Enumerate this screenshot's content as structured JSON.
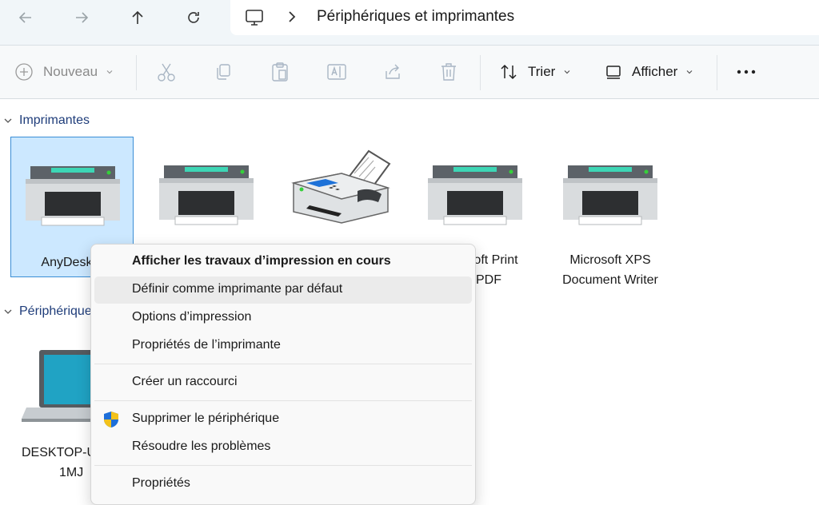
{
  "nav": {
    "back_icon": "arrow-left-icon",
    "forward_icon": "arrow-right-icon",
    "up_icon": "arrow-up-icon",
    "refresh_icon": "refresh-icon",
    "location_icon": "monitor-icon",
    "breadcrumb": "Périphériques et imprimantes"
  },
  "toolbar": {
    "new_label": "Nouveau",
    "sort_label": "Trier",
    "view_label": "Afficher",
    "more_icon": "more-icon"
  },
  "groups": {
    "printers_header": "Imprimantes",
    "devices_header": "Périphérique"
  },
  "printers": [
    {
      "name": "AnyDesk P",
      "icon": "printer-icon",
      "selected": true
    },
    {
      "name": "",
      "icon": "printer-icon"
    },
    {
      "name": "",
      "icon": "fax-icon"
    },
    {
      "name_line1": "oft Print",
      "name_line2": "PDF",
      "icon": "printer-icon"
    },
    {
      "name_line1": "Microsoft XPS",
      "name_line2": "Document Writer",
      "icon": "printer-icon"
    }
  ],
  "devices": [
    {
      "name_line1": "DESKTOP-U",
      "name_line2": "1MJ",
      "icon": "laptop-icon"
    }
  ],
  "context_menu": {
    "items": [
      {
        "label": "Afficher les travaux d’impression en cours",
        "bold": true
      },
      {
        "label": "Définir comme imprimante par défaut",
        "hover": true
      },
      {
        "label": "Options d’impression"
      },
      {
        "label": "Propriétés de l’imprimante"
      },
      {
        "label": "Créer un raccourci"
      },
      {
        "label": "Supprimer le périphérique",
        "icon": "shield-icon"
      },
      {
        "label": "Résoudre les problèmes"
      },
      {
        "label": "Propriétés"
      }
    ]
  },
  "colors": {
    "selection_bg": "#cce8ff",
    "selection_border": "#3a8ed6",
    "group_header": "#1f3d7a"
  }
}
